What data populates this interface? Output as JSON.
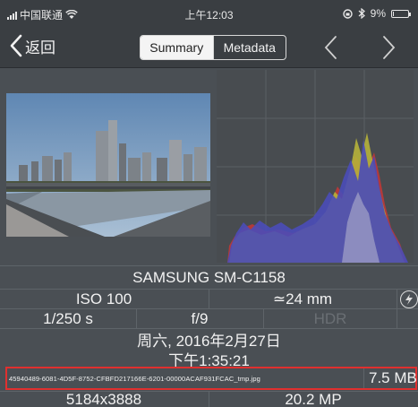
{
  "status": {
    "carrier": "中国联通",
    "time": "上午12:03",
    "battery": "9%",
    "battery_level": 0.09
  },
  "nav": {
    "back_label": "返回",
    "tabs": [
      {
        "label": "Summary",
        "selected": true
      },
      {
        "label": "Metadata",
        "selected": false
      }
    ]
  },
  "info": {
    "camera": "SAMSUNG SM-C1158",
    "iso": "ISO 100",
    "focal": "≃24 mm",
    "shutter": "1/250 s",
    "aperture": "f/9",
    "hdr": "HDR",
    "date": "周六, 2016年2月27日",
    "time": "下午1:35:21",
    "filename": "45940489-6081-4D5F-8752-CFBFD217166E-6201-00000ACAF931FCAC_tmp.jpg",
    "filesize": "7.5 MB",
    "dimensions": "5184x3888",
    "megapixels": "20.2 MP"
  },
  "colors": {
    "highlight_border": "#e0302f",
    "segment_selected_bg": "#f4f4f4"
  }
}
